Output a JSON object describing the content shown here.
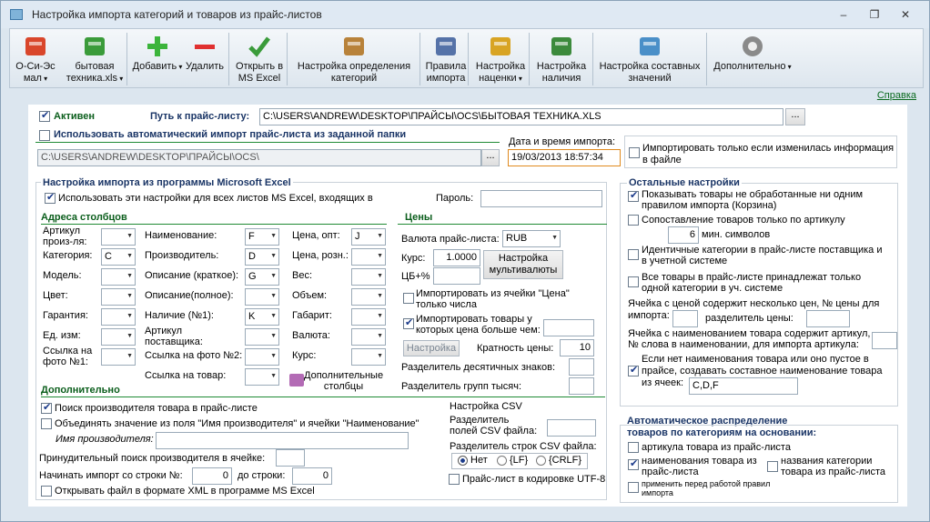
{
  "window": {
    "title": "Настройка импорта категорий и товаров из прайс-листов",
    "min": "–",
    "max": "❐",
    "close": "✕"
  },
  "toolbar": {
    "items": [
      {
        "label": "О-Си-Эс\nмал",
        "icon": "truck-icon",
        "drop": true
      },
      {
        "label": "бытовая\nтехника.xls",
        "icon": "excel-file-icon",
        "drop": true
      },
      {
        "label": "Добавить",
        "icon": "plus-icon",
        "drop": true
      },
      {
        "label": "Удалить",
        "icon": "minus-icon",
        "drop": false
      },
      {
        "label": "Открыть в\nMS Excel",
        "icon": "checkmark-icon",
        "drop": false
      },
      {
        "label": "Настройка определения\nкатегорий",
        "icon": "categories-icon",
        "drop": false
      },
      {
        "label": "Правила\nимпорта",
        "icon": "feather-icon",
        "drop": false
      },
      {
        "label": "Настройка\nнаценки",
        "icon": "coins-icon",
        "drop": true
      },
      {
        "label": "Настройка\nналичия",
        "icon": "cart-icon",
        "drop": false
      },
      {
        "label": "Настройка составных\nзначений",
        "icon": "toolbox-icon",
        "drop": false
      },
      {
        "label": "Дополнительно",
        "icon": "gear-icon",
        "drop": true
      }
    ]
  },
  "help_link": "Справка",
  "top": {
    "active_label": "Активен",
    "path_label": "Путь к прайс-листу:",
    "path_value": "C:\\USERS\\ANDREW\\DESKTOP\\ПРАЙСЫ\\OCS\\БЫТОВАЯ ТЕХНИКА.XLS",
    "browse": "...",
    "auto_import_label": "Использовать автоматический импорт прайс-листа из заданной папки",
    "folder_value": "C:\\USERS\\ANDREW\\DESKTOP\\ПРАЙСЫ\\OCS\\",
    "date_label": "Дата и время импорта:",
    "date_value": "19/03/2013 18:57:34",
    "only_changed_label": "Импортировать только если изменилась информация в файле"
  },
  "excel": {
    "title": "Настройка импорта из программы Microsoft Excel",
    "use_all_label": "Использовать эти настройки для всех листов MS Excel, входящих в",
    "password_label": "Пароль:",
    "columns_title": "Адреса столбцов",
    "col1": [
      {
        "label": "Артикул\nпроиз-ля:",
        "value": ""
      },
      {
        "label": "Категория:",
        "value": "C"
      },
      {
        "label": "Модель:",
        "value": ""
      },
      {
        "label": "Цвет:",
        "value": ""
      },
      {
        "label": "Гарантия:",
        "value": ""
      },
      {
        "label": "Ед. изм:",
        "value": ""
      },
      {
        "label": "Ссылка на\nфото №1:",
        "value": ""
      }
    ],
    "col2": [
      {
        "label": "Наименование:",
        "value": "F"
      },
      {
        "label": "Производитель:",
        "value": "D"
      },
      {
        "label": "Описание (краткое):",
        "value": "G"
      },
      {
        "label": "Описание(полное):",
        "value": ""
      },
      {
        "label": "Наличие (№1):",
        "value": "K"
      },
      {
        "label": "Артикул\nпоставщика:",
        "value": ""
      },
      {
        "label": "Ссылка на фото №2:",
        "value": ""
      },
      {
        "label": "Ссылка на товар:",
        "value": ""
      }
    ],
    "col3": [
      {
        "label": "Цена, опт:",
        "value": "J"
      },
      {
        "label": "Цена, розн.:",
        "value": ""
      },
      {
        "label": "Вес:",
        "value": ""
      },
      {
        "label": "Объем:",
        "value": ""
      },
      {
        "label": "Габарит:",
        "value": ""
      },
      {
        "label": "Валюта:",
        "value": ""
      },
      {
        "label": "Курс:",
        "value": ""
      }
    ],
    "extra_columns": "Дополнительные\nстолбцы",
    "prices_title": "Цены",
    "currency_label": "Валюта прайс-листа:",
    "currency_value": "RUB",
    "rate_label": "Курс:",
    "rate_value": "1.0000",
    "multi_btn": "Настройка\nмультивалюты",
    "cb_label": "ЦБ+%",
    "import_price_cell": "Импортировать из ячейки \"Цена\"\nтолько числа",
    "import_higher": "Импортировать товары у\nкоторых цена больше чем:",
    "setting_btn": "Настройка",
    "multiplicity_label": "Кратность цены:",
    "multiplicity_value": "10",
    "decimal_sep": "Разделитель десятичных знаков:",
    "group_sep": "Разделитель групп тысяч:"
  },
  "additional": {
    "title": "Дополнительно",
    "find_maker": "Поиск производителя товара в прайс-листе",
    "combine": "Объединять значение из поля \"Имя производителя\" и ячейки \"Наименование\"",
    "maker_name": "Имя производителя:",
    "forced": "Принудительный поиск производителя в ячейке:",
    "start_row_label": "Начинать импорт со строки №:",
    "start_row": "0",
    "to_row_label": "до строки:",
    "to_row": "0",
    "xml": "Открывать файл в формате XML в программе MS Excel"
  },
  "csv": {
    "title": "Настройка CSV",
    "field_sep": "Разделитель\nполей CSV файла:",
    "row_sep": "Разделитель строк CSV файла:",
    "opt_no": "Нет",
    "opt_lf": "{LF}",
    "opt_crlf": "{CRLF}",
    "utf8": "Прайс-лист в кодировке UTF-8"
  },
  "other": {
    "title": "Остальные настройки",
    "show_unprocessed": "Показывать товары не обработанные ни одним\nправилом импорта (Корзина)",
    "match_article": "Сопоставление товаров только по артикулу",
    "min_chars_value": "6",
    "min_chars_label": "мин. символов",
    "identical_cat": "Идентичные категории в прайс-листе поставщика и\nв учетной системе",
    "all_in_one": "Все товары в прайс-листе принадлежат только\nодной категории в уч. системе",
    "multi_price": "Ячейка с ценой содержит несколько цен, № цены для\nимпорта:",
    "price_sep": "разделитель цены:",
    "article_in_name": "Ячейка с наименованием товара содержит артикул,\n№ слова в наименовании, для импорта артикула:",
    "compose_name": "Если нет наименования товара или оно пустое в\nпрайсе, создавать составное наименование товара\nиз ячеек:",
    "compose_value": "C,D,F"
  },
  "autodist": {
    "title": "Автоматическое распределение\nтоваров по категориям на основании:",
    "by_article": "артикула товара из прайс-листа",
    "by_name": "наименования товара из\nпрайс-листа",
    "by_catnames": "названия  категории\nтовара из прайс-листа",
    "before_rules": "применить перед работой правил\nимпорта"
  }
}
